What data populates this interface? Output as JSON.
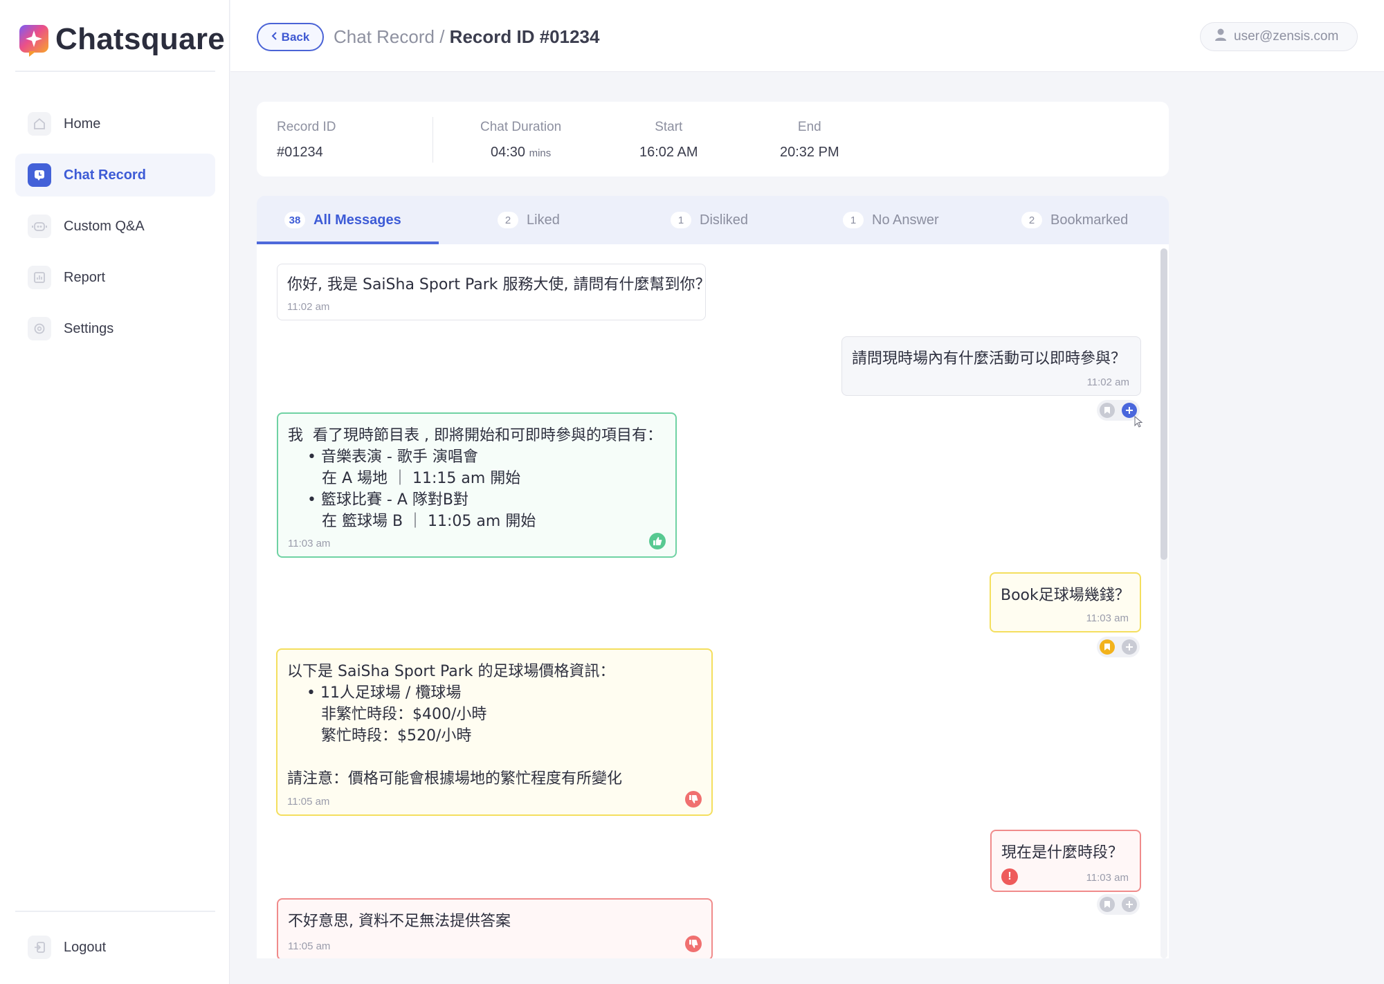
{
  "app": {
    "name": "Chatsquare"
  },
  "sidebar": {
    "items": [
      {
        "label": "Home",
        "icon": "home-icon",
        "active": false
      },
      {
        "label": "Chat Record",
        "icon": "chat-record-icon",
        "active": true
      },
      {
        "label": "Custom Q&A",
        "icon": "robot-icon",
        "active": false
      },
      {
        "label": "Report",
        "icon": "report-icon",
        "active": false
      },
      {
        "label": "Settings",
        "icon": "gear-icon",
        "active": false
      }
    ],
    "logout": "Logout"
  },
  "header": {
    "back_label": "Back",
    "breadcrumb_parent": "Chat Record",
    "breadcrumb_sep": "/",
    "breadcrumb_current": "Record ID #01234",
    "user_email": "user@zensis.com"
  },
  "record": {
    "id_label": "Record ID",
    "id_value": "#01234",
    "duration_label": "Chat Duration",
    "duration_value": "04:30",
    "duration_unit": "mins",
    "start_label": "Start",
    "start_value": "16:02 AM",
    "end_label": "End",
    "end_value": "20:32 PM"
  },
  "tabs": [
    {
      "count": "38",
      "label": "All Messages",
      "active": true
    },
    {
      "count": "2",
      "label": "Liked",
      "active": false
    },
    {
      "count": "1",
      "label": "Disliked",
      "active": false
    },
    {
      "count": "1",
      "label": "No Answer",
      "active": false
    },
    {
      "count": "2",
      "label": "Bookmarked",
      "active": false
    }
  ],
  "messages": [
    {
      "role": "bot",
      "text": "你好, 我是 SaiSha Sport Park 服務大使, 請問有什麼幫到你？",
      "time": "11:02 am"
    },
    {
      "role": "user",
      "text": "請問現時場內有什麼活動可以即時參與？",
      "time": "11:02 am"
    },
    {
      "role": "bot",
      "text": "我  看了現時節目表 , 即將開始和可即時參與的項目有：\n    • 音樂表演 - 歌手 演唱會\n       在 A 場地 ｜ 11:15 am 開始\n    • 籃球比賽 - A 隊對B對\n       在 籃球場 B ｜ 11:05 am 開始",
      "time": "11:03 am",
      "reaction": "liked"
    },
    {
      "role": "user",
      "text": "Book足球場幾錢？",
      "time": "11:03 am",
      "bookmarked": true
    },
    {
      "role": "bot",
      "text": "以下是 SaiSha Sport Park 的足球場價格資訊：\n    • 11人足球場 / 欖球場\n       非繁忙時段：$400/小時\n       繁忙時段：$520/小時\n\n請注意：價格可能會根據場地的繁忙程度有所變化",
      "time": "11:05 am",
      "reaction": "disliked"
    },
    {
      "role": "user",
      "text": "現在是什麼時段？",
      "time": "11:03 am",
      "no_answer": true
    },
    {
      "role": "bot",
      "text": "不好意思, 資料不足無法提供答案",
      "time": "11:05 am",
      "reaction": "disliked"
    }
  ],
  "colors": {
    "accent": "#4361d8",
    "liked": "#57c991",
    "disliked": "#f07070",
    "bookmark": "#f2b21c"
  }
}
